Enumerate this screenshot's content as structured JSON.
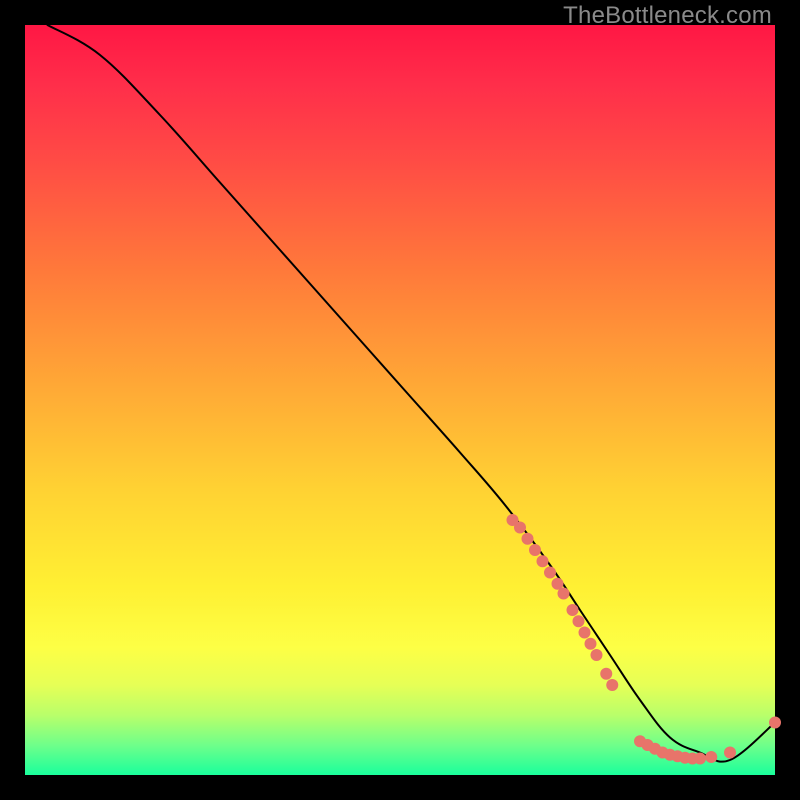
{
  "watermark": {
    "text": "TheBottleneck.com"
  },
  "chart_data": {
    "type": "line",
    "title": "",
    "xlabel": "",
    "ylabel": "",
    "xlim": [
      0,
      100
    ],
    "ylim": [
      0,
      100
    ],
    "grid": false,
    "series": [
      {
        "name": "curve",
        "x": [
          3,
          10,
          18,
          26,
          34,
          42,
          50,
          58,
          64,
          70,
          74,
          78,
          82,
          86,
          90,
          94,
          100
        ],
        "y": [
          100,
          96,
          88,
          79,
          70,
          61,
          52,
          43,
          36,
          28,
          22,
          16,
          10,
          5,
          3,
          2,
          7
        ]
      }
    ],
    "cluster_points": {
      "upper_segment": [
        {
          "x": 65,
          "y": 34
        },
        {
          "x": 66,
          "y": 33
        },
        {
          "x": 67,
          "y": 31.5
        },
        {
          "x": 68,
          "y": 30
        },
        {
          "x": 69,
          "y": 28.5
        },
        {
          "x": 70,
          "y": 27
        },
        {
          "x": 71,
          "y": 25.5
        },
        {
          "x": 71.8,
          "y": 24.2
        },
        {
          "x": 73,
          "y": 22
        },
        {
          "x": 73.8,
          "y": 20.5
        },
        {
          "x": 74.6,
          "y": 19
        },
        {
          "x": 75.4,
          "y": 17.5
        },
        {
          "x": 76.2,
          "y": 16
        },
        {
          "x": 77.5,
          "y": 13.5
        },
        {
          "x": 78.3,
          "y": 12
        }
      ],
      "bottom_segment": [
        {
          "x": 82,
          "y": 4.5
        },
        {
          "x": 83,
          "y": 4
        },
        {
          "x": 84,
          "y": 3.5
        },
        {
          "x": 85,
          "y": 3
        },
        {
          "x": 86,
          "y": 2.7
        },
        {
          "x": 87,
          "y": 2.5
        },
        {
          "x": 88,
          "y": 2.3
        },
        {
          "x": 89,
          "y": 2.2
        },
        {
          "x": 90,
          "y": 2.2
        },
        {
          "x": 91.5,
          "y": 2.4
        },
        {
          "x": 94,
          "y": 3
        }
      ],
      "end_point": [
        {
          "x": 100,
          "y": 7
        }
      ]
    },
    "point_style": {
      "radius": 6,
      "fill": "#e8746a"
    },
    "line_style": {
      "stroke": "#000000",
      "width": 2
    }
  }
}
